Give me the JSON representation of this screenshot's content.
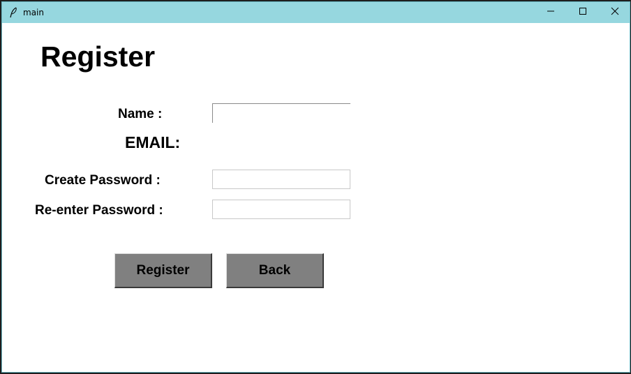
{
  "window": {
    "title": "main",
    "icon": "feather-icon",
    "controls": [
      "minimize-icon",
      "maximize-icon",
      "close-icon"
    ],
    "titlebar_color": "#96d7df"
  },
  "form": {
    "heading": "Register",
    "name_label": "Name :",
    "name_value": "",
    "email_label": "EMAIL:",
    "create_password_label": "Create Password :",
    "create_password_value": "",
    "reenter_password_label": "Re-enter Password :",
    "reenter_password_value": "",
    "register_button": "Register",
    "back_button": "Back",
    "button_color": "#808080"
  }
}
